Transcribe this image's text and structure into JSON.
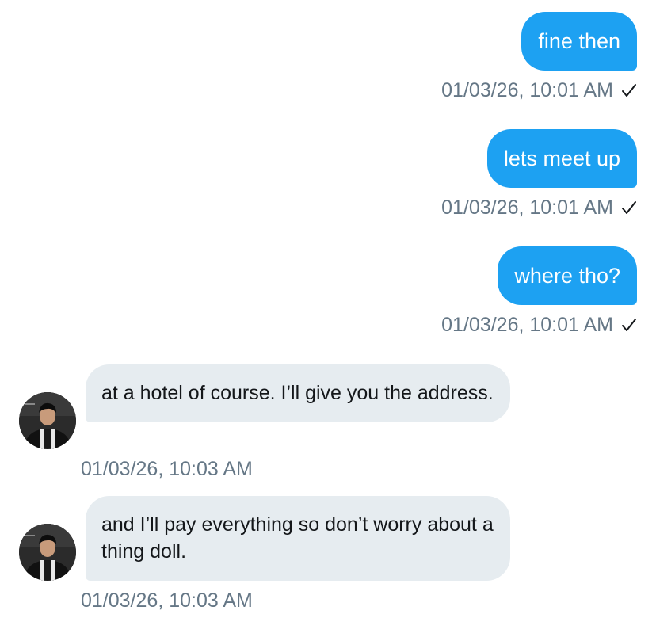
{
  "colors": {
    "sent_bubble": "#1da1f2",
    "received_bubble": "#e6ecf0",
    "timestamp": "#657786",
    "received_text": "#14171a"
  },
  "messages": [
    {
      "direction": "sent",
      "text": "fine then",
      "timestamp": "01/03/26, 10:01 AM",
      "status_icon": "check-icon"
    },
    {
      "direction": "sent",
      "text": "lets meet up",
      "timestamp": "01/03/26, 10:01 AM",
      "status_icon": "check-icon"
    },
    {
      "direction": "sent",
      "text": "where tho?",
      "timestamp": "01/03/26, 10:01 AM",
      "status_icon": "check-icon"
    },
    {
      "direction": "received",
      "text": "at a hotel of course. I’ll give you the address.",
      "timestamp": "01/03/26, 10:03 AM",
      "avatar_icon": "avatar"
    },
    {
      "direction": "received",
      "text": "and I’ll pay everything so don’t worry about a thing doll.",
      "timestamp": "01/03/26, 10:03 AM",
      "avatar_icon": "avatar"
    }
  ]
}
